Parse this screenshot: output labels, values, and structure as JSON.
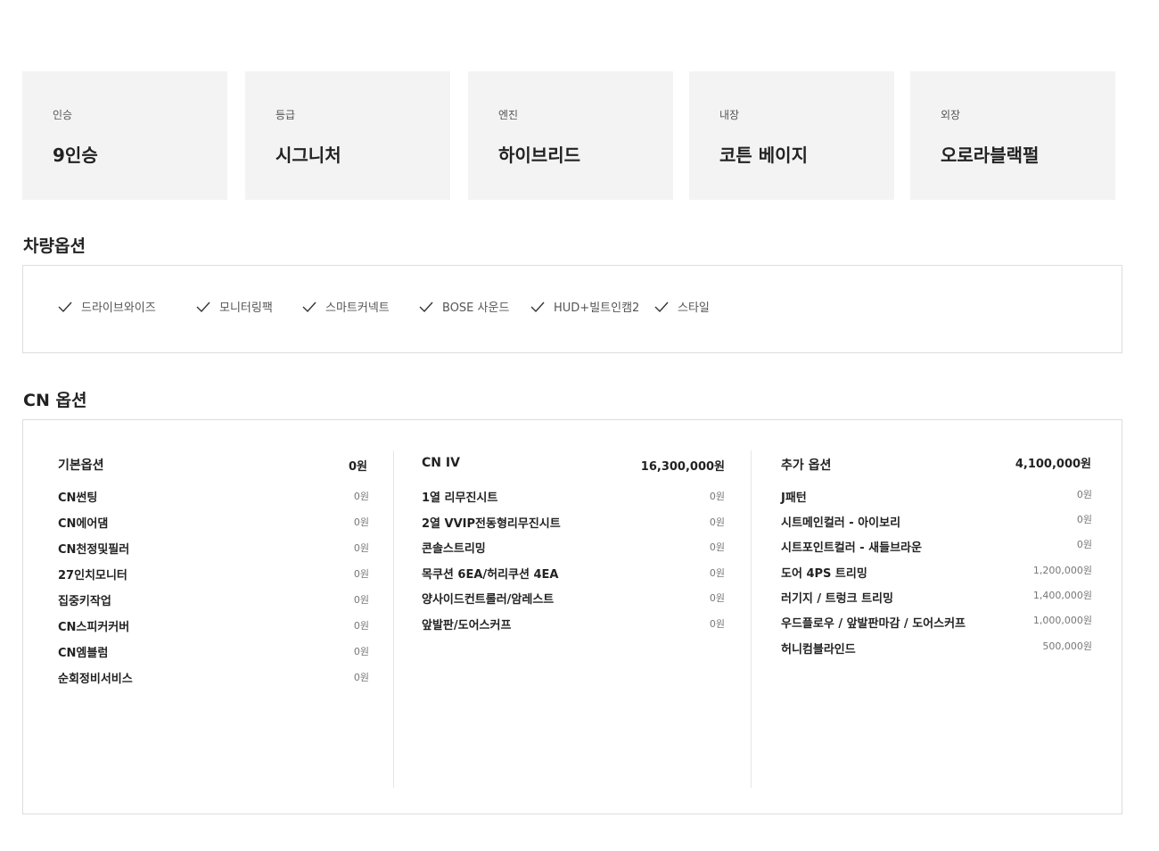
{
  "specs": [
    {
      "label": "인승",
      "value": "9인승"
    },
    {
      "label": "등급",
      "value": "시그니처"
    },
    {
      "label": "엔진",
      "value": "하이브리드"
    },
    {
      "label": "내장",
      "value": "코튼 베이지"
    },
    {
      "label": "외장",
      "value": "오로라블랙펄"
    }
  ],
  "vehicle_options": {
    "title": "차량옵션",
    "items": [
      "드라이브와이즈",
      "모니터링팩",
      "스마트커넥트",
      "BOSE 사운드",
      "HUD+빌트인캠2",
      "스타일"
    ]
  },
  "cn_options": {
    "title": "CN 옵션",
    "columns": [
      {
        "header": "기본옵션",
        "total": "0원",
        "items": [
          {
            "name": "CN썬팅",
            "price": "0원"
          },
          {
            "name": "CN에어댐",
            "price": "0원"
          },
          {
            "name": "CN천정및필러",
            "price": "0원"
          },
          {
            "name": "27인치모니터",
            "price": "0원"
          },
          {
            "name": "집중키작업",
            "price": "0원"
          },
          {
            "name": "CN스피커커버",
            "price": "0원"
          },
          {
            "name": "CN엠블럼",
            "price": "0원"
          },
          {
            "name": "순회정비서비스",
            "price": "0원"
          }
        ]
      },
      {
        "header": "CN IV",
        "total": "16,300,000원",
        "items": [
          {
            "name": "1열 리무진시트",
            "price": "0원"
          },
          {
            "name": "2열 VVIP전동형리무진시트",
            "price": "0원"
          },
          {
            "name": "콘솔스트리밍",
            "price": "0원"
          },
          {
            "name": "목쿠션 6EA/허리쿠션 4EA",
            "price": "0원"
          },
          {
            "name": "양사이드컨트롤러/암레스트",
            "price": "0원"
          },
          {
            "name": "앞발판/도어스커프",
            "price": "0원"
          }
        ]
      },
      {
        "header": "추가 옵션",
        "total": "4,100,000원",
        "items": [
          {
            "name": "J패턴",
            "price": "0원"
          },
          {
            "name": "시트메인컬러 - 아이보리",
            "price": "0원"
          },
          {
            "name": "시트포인트컬러 - 새들브라운",
            "price": "0원"
          },
          {
            "name": "도어 4PS 트리밍",
            "price": "1,200,000원"
          },
          {
            "name": "러기지 / 트렁크 트리밍",
            "price": "1,400,000원"
          },
          {
            "name": "우드플로우 / 앞발판마감 / 도어스커프",
            "price": "1,000,000원"
          },
          {
            "name": "허니컴블라인드",
            "price": "500,000원"
          }
        ]
      }
    ]
  }
}
